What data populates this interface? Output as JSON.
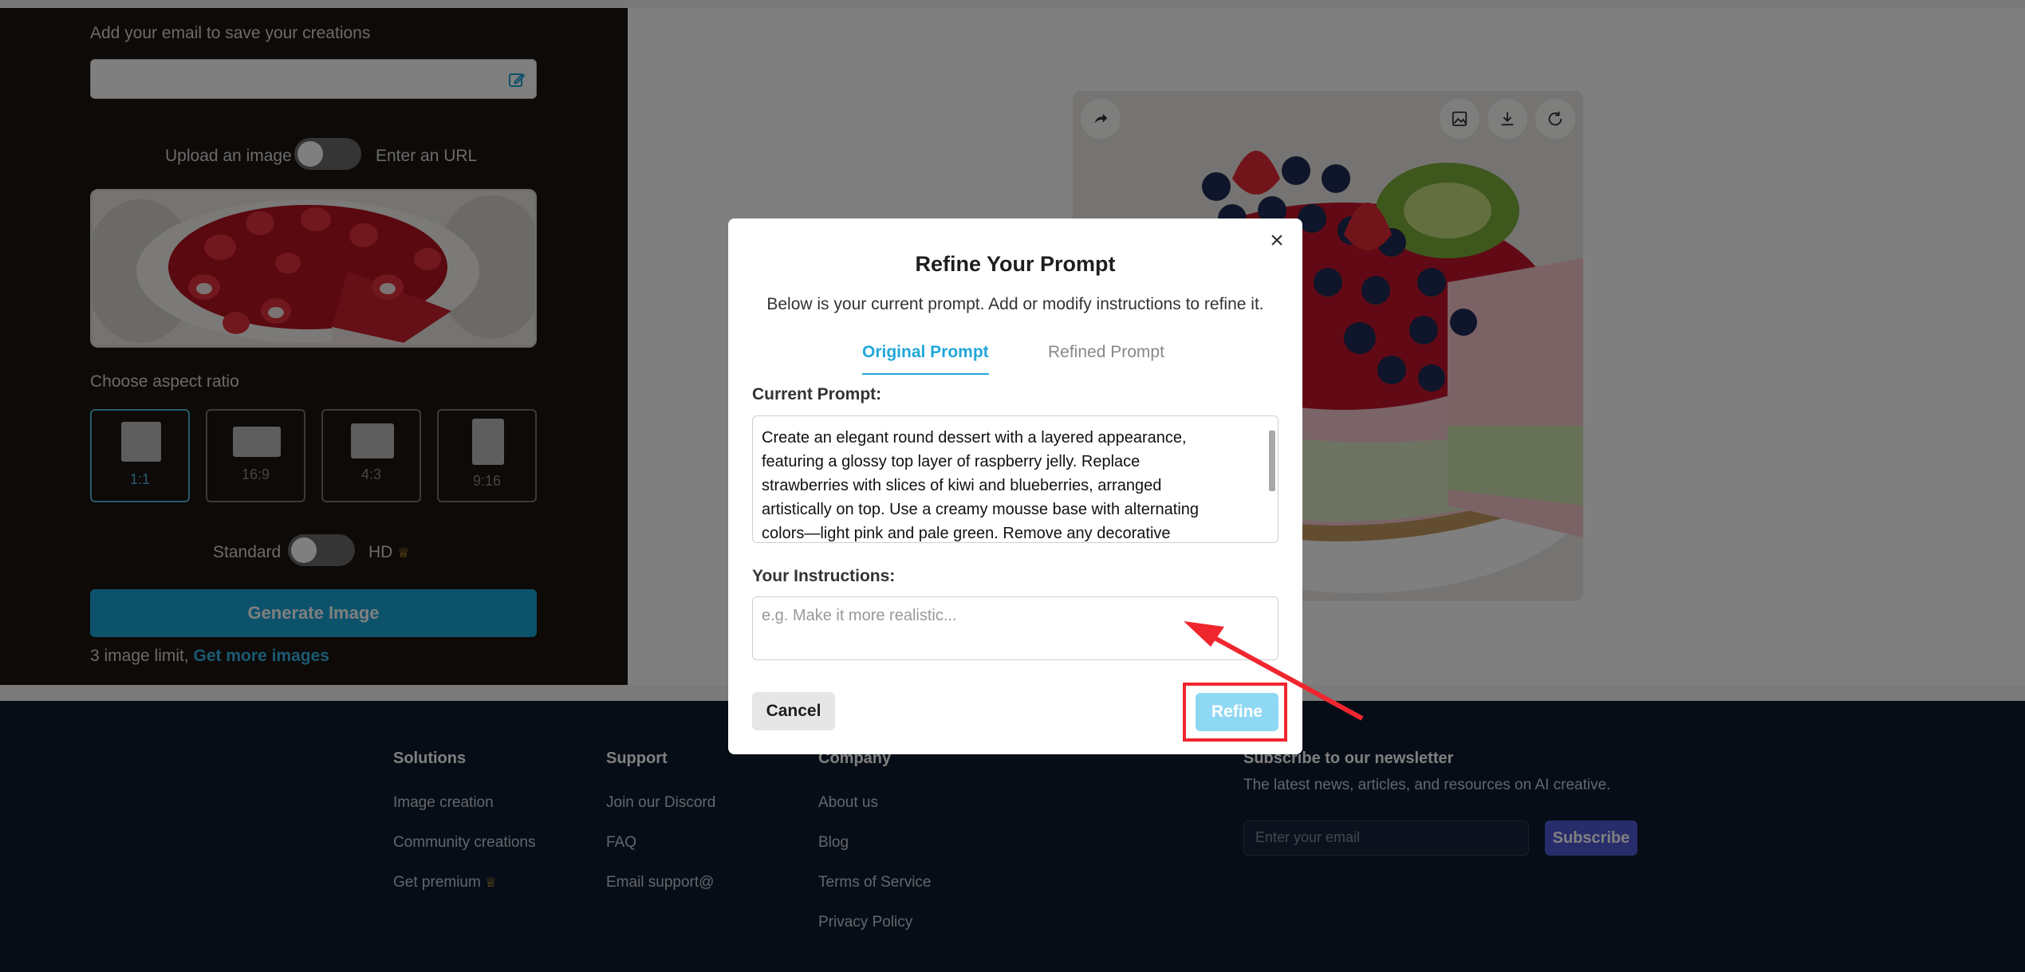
{
  "sidebar": {
    "email_label": "Add your email to save your creations",
    "email_value": "",
    "upload_label": "Upload an image",
    "url_label": "Enter an URL",
    "aspect_label": "Choose aspect ratio",
    "ratios": [
      {
        "label": "1:1",
        "selected": true
      },
      {
        "label": "16:9",
        "selected": false
      },
      {
        "label": "4:3",
        "selected": false
      },
      {
        "label": "9:16",
        "selected": false
      }
    ],
    "standard_label": "Standard",
    "hd_label": "HD",
    "generate_label": "Generate Image",
    "limit_text": "3 image limit,",
    "more_link": "Get more images"
  },
  "footer": {
    "solutions": {
      "title": "Solutions",
      "links": [
        "Image creation",
        "Community creations",
        "Get premium"
      ]
    },
    "support": {
      "title": "Support",
      "links": [
        "Join our Discord",
        "FAQ",
        "Email support@"
      ]
    },
    "company": {
      "title": "Company",
      "links": [
        "About us",
        "Blog",
        "Terms of Service",
        "Privacy Policy"
      ]
    },
    "newsletter": {
      "title": "Subscribe to our newsletter",
      "subtitle": "The latest news, articles, and resources on AI creative.",
      "placeholder": "Enter your email",
      "button": "Subscribe"
    }
  },
  "modal": {
    "title": "Refine Your Prompt",
    "subtitle": "Below is your current prompt. Add or modify instructions to refine it.",
    "tabs": [
      {
        "label": "Original Prompt",
        "active": true
      },
      {
        "label": "Refined Prompt",
        "active": false
      }
    ],
    "current_label": "Current Prompt:",
    "current_lines": [
      "Create an elegant round dessert with a layered appearance,",
      "featuring a glossy top layer of raspberry jelly. Replace",
      "strawberries with slices of kiwi and blueberries, arranged",
      "artistically on top. Use a creamy mousse base with alternating",
      "colors—light pink and pale green. Remove any decorative"
    ],
    "instructions_label": "Your Instructions:",
    "instructions_placeholder": "e.g. Make it more realistic...",
    "cancel_label": "Cancel",
    "refine_label": "Refine",
    "close_glyph": "×"
  },
  "colors": {
    "accent": "#22a7d9",
    "refine_disabled": "#8fd8f3",
    "highlight": "#f0262f",
    "footer_bg": "#0f1a2e",
    "sidebar_bg": "#1a1411",
    "subscribe": "#4f5bd5"
  },
  "icons": {
    "edit": "pencil-square-icon",
    "share": "share-arrow-icon",
    "image": "image-icon",
    "download": "download-icon",
    "regenerate": "refresh-icon",
    "crown": "crown-icon",
    "close": "close-icon"
  }
}
